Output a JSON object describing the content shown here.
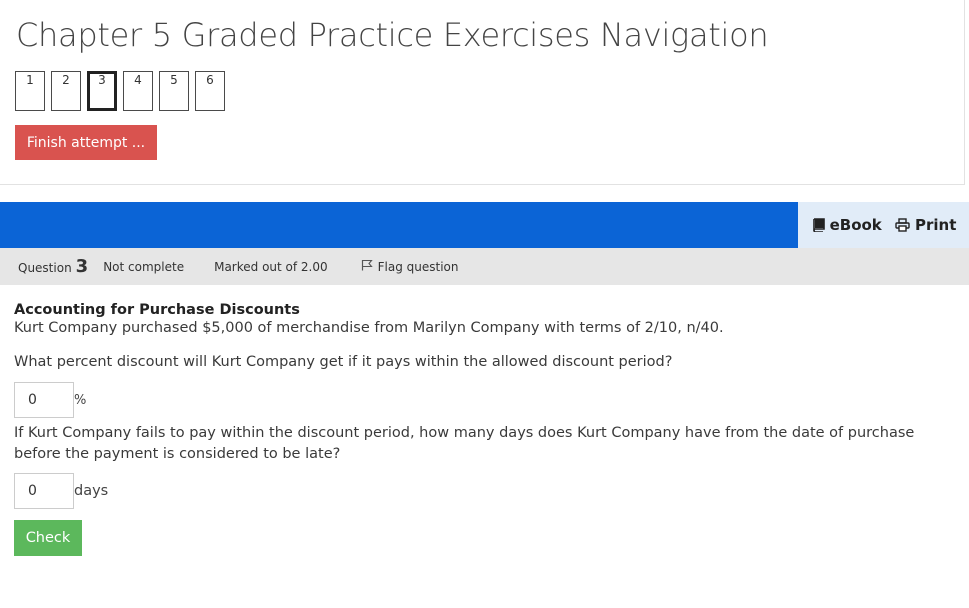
{
  "navigation": {
    "title": "Chapter 5 Graded Practice Exercises Navigation",
    "questions": [
      "1",
      "2",
      "3",
      "4",
      "5",
      "6"
    ],
    "current_question": "3",
    "finish_label": "Finish attempt ..."
  },
  "toolbar": {
    "ebook_label": "eBook",
    "print_label": "Print",
    "bar_color": "#0b64d6"
  },
  "question_info": {
    "question_label": "Question",
    "question_number": "3",
    "state": "Not complete",
    "grade": "Marked out of 2.00",
    "flag_label": "Flag question"
  },
  "question": {
    "title": "Accounting for Purchase Discounts",
    "intro": "Kurt Company purchased $5,000 of merchandise from Marilyn Company with terms of 2/10, n/40.",
    "prompt1": "What percent discount will Kurt Company get if it pays within the allowed discount period?",
    "answer1_value": "0",
    "answer1_unit": "%",
    "prompt2": "If Kurt Company fails to pay within the discount period, how many days does Kurt Company have from the date of purchase before the payment is considered to be late?",
    "answer2_value": "0",
    "answer2_unit": "days",
    "check_label": "Check"
  }
}
